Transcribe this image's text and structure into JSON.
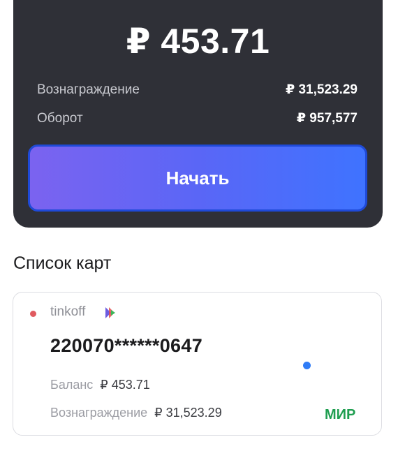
{
  "summary": {
    "balance": "₽ 453.71",
    "reward_label": "Вознаграждение",
    "reward_value": "₽ 31,523.29",
    "turnover_label": "Оборот",
    "turnover_value": "₽ 957,577",
    "start_button": "Начать"
  },
  "cards_section": {
    "title": "Список карт"
  },
  "card": {
    "bank": "tinkoff",
    "number": "220070******0647",
    "balance_label": "Баланс",
    "balance_value": "₽ 453.71",
    "reward_label": "Вознаграждение",
    "reward_value": "₽ 31,523.29",
    "network": "МИР"
  },
  "colors": {
    "dark_bg": "#2f3037",
    "button_start": "#7b63f0",
    "button_end": "#3f73ff",
    "status_red": "#e05a5f",
    "status_blue": "#2f7cf6",
    "mir_green": "#1f9e50"
  }
}
